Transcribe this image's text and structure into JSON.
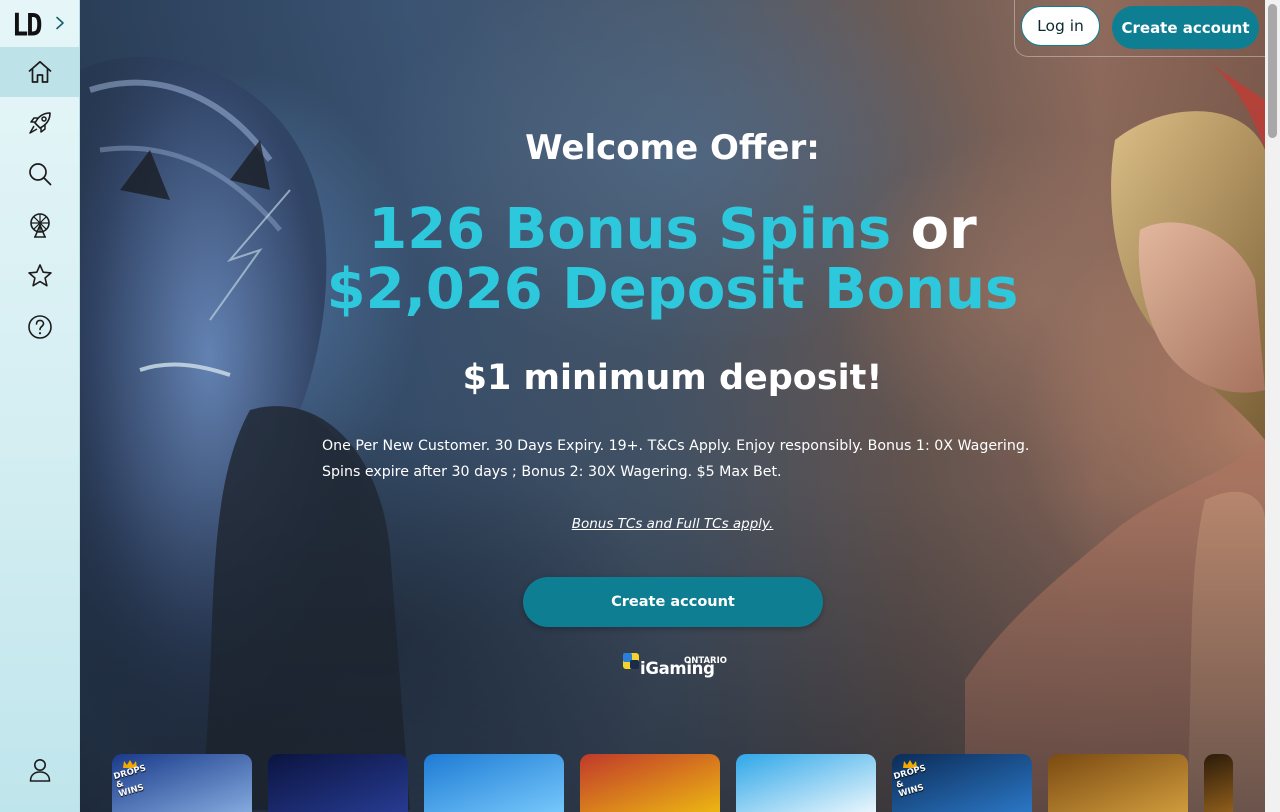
{
  "brand": {
    "logo_text": "LD"
  },
  "sidebar": {
    "items": [
      {
        "name": "home",
        "icon": "home-icon",
        "active": true
      },
      {
        "name": "new-games",
        "icon": "rocket-icon",
        "active": false
      },
      {
        "name": "search",
        "icon": "search-icon",
        "active": false
      },
      {
        "name": "live-casino",
        "icon": "ferris-wheel-icon",
        "active": false
      },
      {
        "name": "favourites",
        "icon": "star-icon",
        "active": false
      },
      {
        "name": "help",
        "icon": "help-icon",
        "active": false
      }
    ],
    "account_icon": "user-icon",
    "expand_icon": "chevron-right-icon"
  },
  "header": {
    "login_label": "Log in",
    "create_account_label": "Create account"
  },
  "hero": {
    "welcome": "Welcome Offer:",
    "offer_spins": "126 Bonus Spins",
    "offer_or": "or",
    "offer_deposit": "$2,026 Deposit Bonus",
    "min_deposit": "$1 minimum deposit!",
    "terms": "One Per New Customer. 30 Days Expiry. 19+. T&Cs Apply. Enjoy responsibly. Bonus 1: 0X Wagering. Spins expire after 30 days ; Bonus 2: 30X Wagering. $5 Max Bet.",
    "terms_link": "Bonus TCs and Full TCs apply.",
    "cta_label": "Create account",
    "regulator": {
      "word": "iGaming",
      "region": "ONTARIO"
    }
  },
  "games": {
    "tiles": [
      {
        "badge": "DROPS & WINS",
        "palette": [
          "#1a3a8a",
          "#8fb6e6"
        ]
      },
      {
        "badge": "",
        "palette": [
          "#0b1440",
          "#2a3f9a"
        ]
      },
      {
        "badge": "",
        "palette": [
          "#1e7bd4",
          "#7fd0ff"
        ]
      },
      {
        "badge": "",
        "palette": [
          "#c0392b",
          "#f1c40f"
        ]
      },
      {
        "badge": "",
        "palette": [
          "#2fa7e8",
          "#ffffff"
        ]
      },
      {
        "badge": "DROPS & WINS",
        "palette": [
          "#0c2c57",
          "#2e7fd1"
        ]
      },
      {
        "badge": "",
        "palette": [
          "#7a4a12",
          "#d9a441"
        ]
      },
      {
        "badge": "",
        "palette": [
          "#2b1a0a",
          "#a06a1e"
        ]
      }
    ]
  },
  "colors": {
    "accent_cyan": "#2ec8dd",
    "primary_teal": "#0e7f93",
    "sidebar_bg": "#d4eef2",
    "sidebar_active": "#bde2e8"
  }
}
